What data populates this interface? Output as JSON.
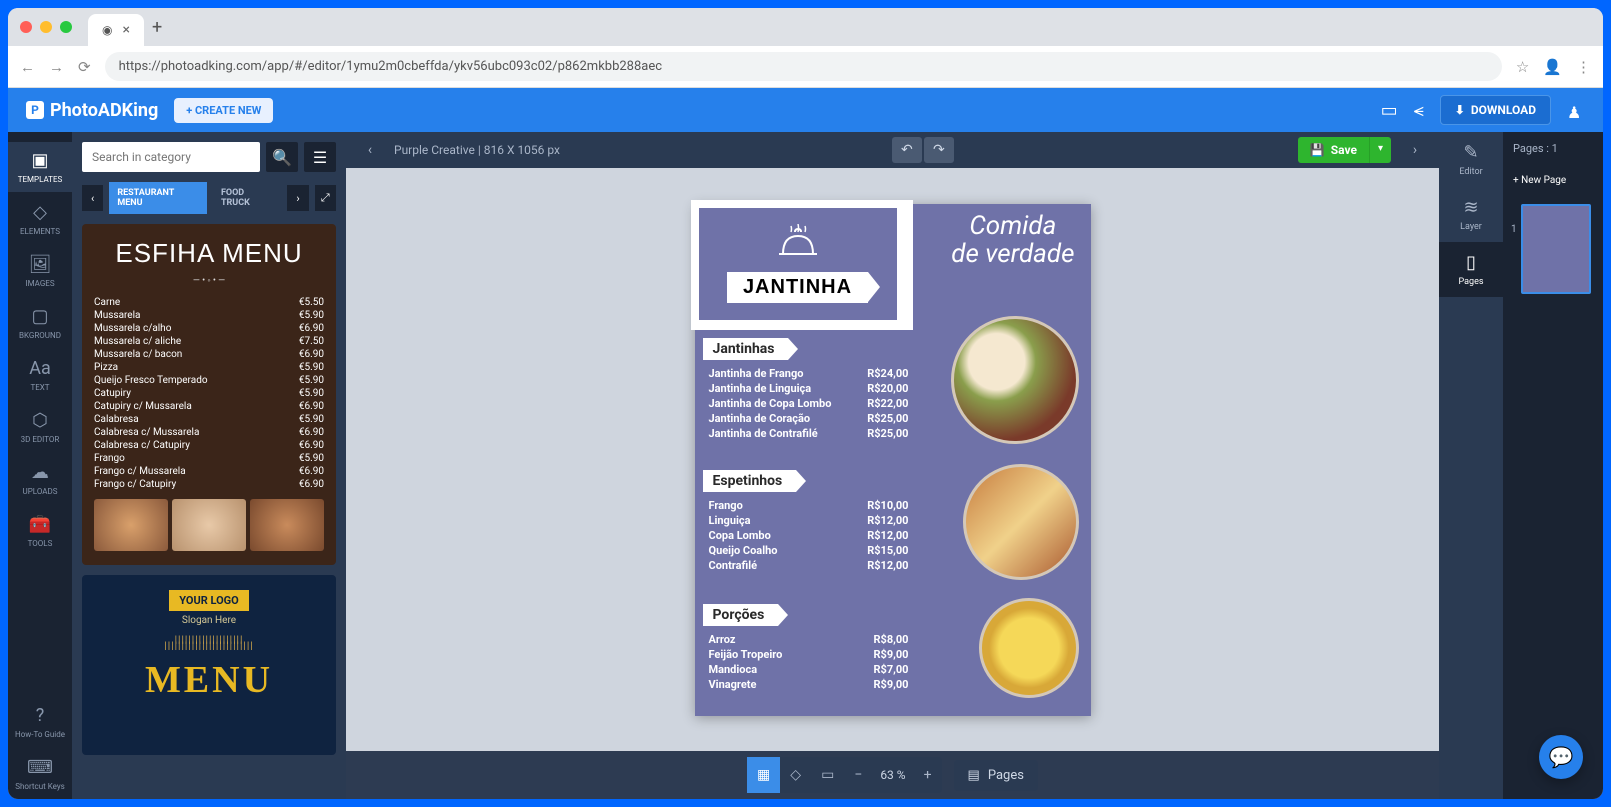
{
  "browser": {
    "url": "https://photoadking.com/app/#/editor/1ymu2m0cbeffda/ykv56ubc093c02/p862mkbb288aec"
  },
  "toolbar": {
    "brand": "PhotoADKing",
    "create": "+ CREATE NEW",
    "download": "DOWNLOAD"
  },
  "rail": [
    "TEMPLATES",
    "ELEMENTS",
    "IMAGES",
    "BKGROUND",
    "TEXT",
    "3D EDITOR",
    "UPLOADS",
    "TOOLS"
  ],
  "rail_bottom": [
    "How-To Guide",
    "Shortcut Keys"
  ],
  "search": {
    "placeholder": "Search in category"
  },
  "categories": {
    "active": "RESTAURANT MENU",
    "other": "FOOD TRUCK"
  },
  "template1": {
    "title": "ESFIHA MENU",
    "items": [
      {
        "n": "Carne",
        "p": "€5.50"
      },
      {
        "n": "Mussarela",
        "p": "€5.90"
      },
      {
        "n": "Mussarela c/alho",
        "p": "€6.90"
      },
      {
        "n": "Mussarela c/ aliche",
        "p": "€7.50"
      },
      {
        "n": "Mussarela c/ bacon",
        "p": "€6.90"
      },
      {
        "n": "Pizza",
        "p": "€5.90"
      },
      {
        "n": "Queijo Fresco Temperado",
        "p": "€5.90"
      },
      {
        "n": "Catupiry",
        "p": "€5.90"
      },
      {
        "n": "Catupiry c/ Mussarela",
        "p": "€6.90"
      },
      {
        "n": "Calabresa",
        "p": "€5.90"
      },
      {
        "n": "Calabresa c/ Mussarela",
        "p": "€6.90"
      },
      {
        "n": "Calabresa c/ Catupiry",
        "p": "€6.90"
      },
      {
        "n": "Frango",
        "p": "€5.90"
      },
      {
        "n": "Frango c/ Mussarela",
        "p": "€6.90"
      },
      {
        "n": "Frango c/ Catupiry",
        "p": "€6.90"
      }
    ]
  },
  "template2": {
    "logo": "YOUR LOGO",
    "slogan": "Slogan Here",
    "menu": "MENU"
  },
  "doc": {
    "title": "Purple Creative | 816 X 1056 px",
    "save": "Save"
  },
  "canvas": {
    "badge": "JANTINHA",
    "headline1": "Comida",
    "headline2": "de verdade",
    "sec1": {
      "title": "Jantinhas",
      "items": [
        {
          "n": "Jantinha de Frango",
          "p": "R$24,00"
        },
        {
          "n": "Jantinha de Linguiça",
          "p": "R$20,00"
        },
        {
          "n": "Jantinha de Copa Lombo",
          "p": "R$22,00"
        },
        {
          "n": "Jantinha de Coração",
          "p": "R$25,00"
        },
        {
          "n": "Jantinha de Contrafilé",
          "p": "R$25,00"
        }
      ]
    },
    "sec2": {
      "title": "Espetinhos",
      "items": [
        {
          "n": "Frango",
          "p": "R$10,00"
        },
        {
          "n": "Linguiça",
          "p": "R$12,00"
        },
        {
          "n": "Copa Lombo",
          "p": "R$12,00"
        },
        {
          "n": "Queijo Coalho",
          "p": "R$15,00"
        },
        {
          "n": "Contrafilé",
          "p": "R$12,00"
        }
      ]
    },
    "sec3": {
      "title": "Porções",
      "items": [
        {
          "n": "Arroz",
          "p": "R$8,00"
        },
        {
          "n": "Feijão Tropeiro",
          "p": "R$9,00"
        },
        {
          "n": "Mandioca",
          "p": "R$7,00"
        },
        {
          "n": "Vinagrete",
          "p": "R$9,00"
        }
      ]
    }
  },
  "zoom": "63 %",
  "pages_btn": "Pages",
  "dock": [
    "Editor",
    "Layer",
    "Pages"
  ],
  "pages_panel": {
    "label": "Pages : 1",
    "new": "+  New Page",
    "num": "1"
  }
}
